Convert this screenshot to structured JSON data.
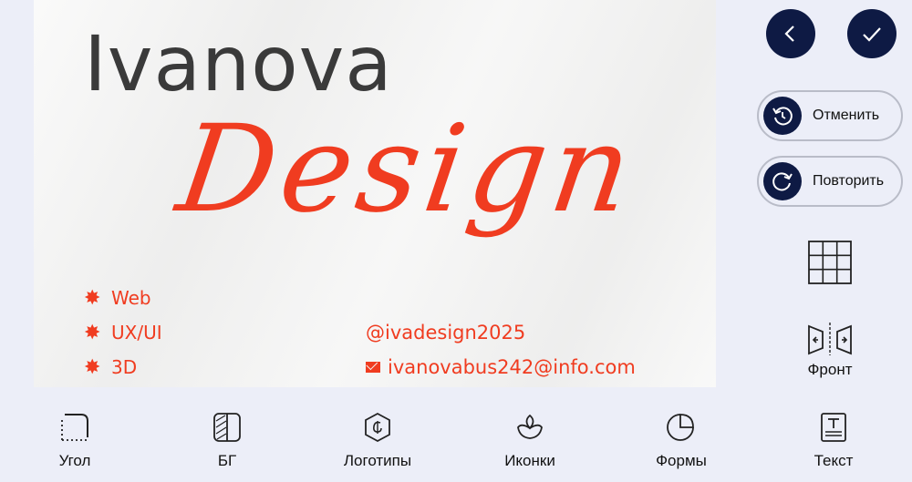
{
  "canvas": {
    "brand_name": "Ivanova",
    "brand_script": "Design",
    "services": [
      "Web",
      "UX/UI",
      "3D"
    ],
    "contacts": [
      {
        "icon": "at-icon",
        "text": "@ivadesign2025"
      },
      {
        "icon": "mail-icon",
        "text": "ivanovabus242@info.com"
      }
    ],
    "colors": {
      "accent": "#f03c20",
      "text_dark": "#3a3a3a",
      "background": "#f3f3f2"
    }
  },
  "header": {
    "back_icon": "chevron-left-icon",
    "confirm_icon": "checkmark-icon"
  },
  "actions": {
    "undo_label": "Отменить",
    "redo_label": "Повторить"
  },
  "side_tools": {
    "grid_icon": "grid-icon",
    "flip_label": "Фронт"
  },
  "bottom_toolbar": {
    "items": [
      {
        "label": "Угол",
        "icon": "corner-icon"
      },
      {
        "label": "БГ",
        "icon": "background-icon"
      },
      {
        "label": "Логотипы",
        "icon": "logo-icon"
      },
      {
        "label": "Иконки",
        "icon": "icons-icon"
      },
      {
        "label": "Формы",
        "icon": "shapes-icon"
      },
      {
        "label": "Текст",
        "icon": "text-icon"
      }
    ]
  },
  "theme": {
    "primary": "#0e1a44",
    "panel_bg": "#eceef8"
  }
}
